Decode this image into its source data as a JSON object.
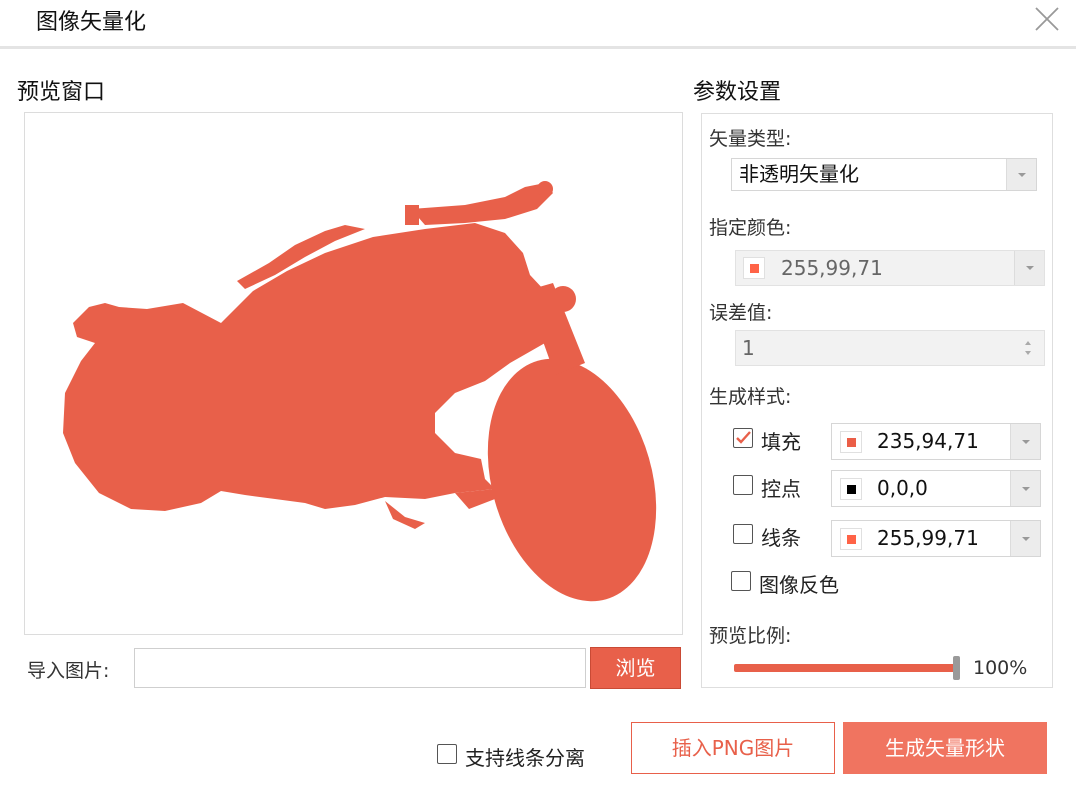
{
  "dialog": {
    "title": "图像矢量化"
  },
  "preview": {
    "heading": "预览窗口",
    "import_label": "导入图片:",
    "import_value": "",
    "browse_label": "浏览"
  },
  "params": {
    "heading": "参数设置",
    "vector_type_label": "矢量类型:",
    "vector_type_value": "非透明矢量化",
    "color_label": "指定颜色:",
    "color_value": "255,99,71",
    "tolerance_label": "误差值:",
    "tolerance_value": "1",
    "style_label": "生成样式:",
    "styles": [
      {
        "label": "填充",
        "checked": true,
        "color": "235,94,71",
        "swatch": "#eb5e47"
      },
      {
        "label": "控点",
        "checked": false,
        "color": "0,0,0",
        "swatch": "#000000"
      },
      {
        "label": "线条",
        "checked": false,
        "color": "255,99,71",
        "swatch": "#ff6347"
      }
    ],
    "invert_label": "图像反色",
    "invert_checked": false,
    "preview_scale_label": "预览比例:",
    "preview_scale_value": "100%",
    "preview_scale_fraction": 1.0
  },
  "footer": {
    "separate_lines_label": "支持线条分离",
    "separate_lines_checked": false,
    "insert_png_label": "插入PNG图片",
    "generate_label": "生成矢量形状"
  },
  "colors": {
    "accent": "#e8604a",
    "silhouette": "#e8604a",
    "specified": "#ff6347"
  }
}
